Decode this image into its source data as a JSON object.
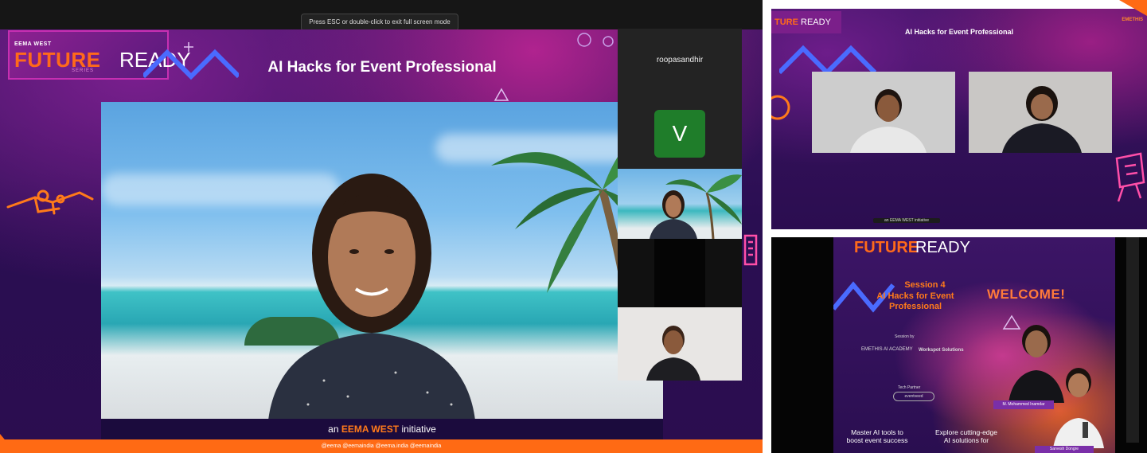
{
  "left_screen": {
    "esc_tip": "Press ESC or double-click to exit full screen mode",
    "brand": {
      "small": "EEMA WEST",
      "future": "FUTURE",
      "ready": "READY",
      "series": "SERIES"
    },
    "title": "AI Hacks for Event Professional",
    "speaker_label": {
      "prefix": "an",
      "accent": "EEMA WEST",
      "suffix": "initiative"
    },
    "social_bar": "@eema  @eemaindia  @eema.india  @eemaindia",
    "participants": [
      {
        "name": "roopasandhir"
      },
      {
        "avatar_letter": "V"
      }
    ]
  },
  "right_top": {
    "brand_accent": "TURE",
    "brand_rest": "READY",
    "title": "AI Hacks for Event Professional",
    "logo": "EMETHIS",
    "bottom_tag": "an EEMA WEST initiative"
  },
  "right_bottom": {
    "brand_future": "FUTURE",
    "brand_ready": "READY",
    "session": "Session 4",
    "session_title": "AI Hacks for Event Professional",
    "welcome": "WELCOME!",
    "sponsor_label": "Session by",
    "sponsor1": "EMETHIS AI ACADEMY",
    "sponsor2": "Workspot Solutions",
    "partner_label": "Tech Partner",
    "partner": "eventveed",
    "bullet1": "Master AI tools to boost event success",
    "bullet2": "Explore cutting-edge AI solutions for",
    "speaker1_tag": "M. Mohammed Inamdar",
    "speaker2_tag": "Sarvesh Dongre"
  },
  "colors": {
    "accent_orange": "#ff6a14",
    "brand_purple": "#3c1563",
    "avatar_green": "#1f7d2a"
  }
}
